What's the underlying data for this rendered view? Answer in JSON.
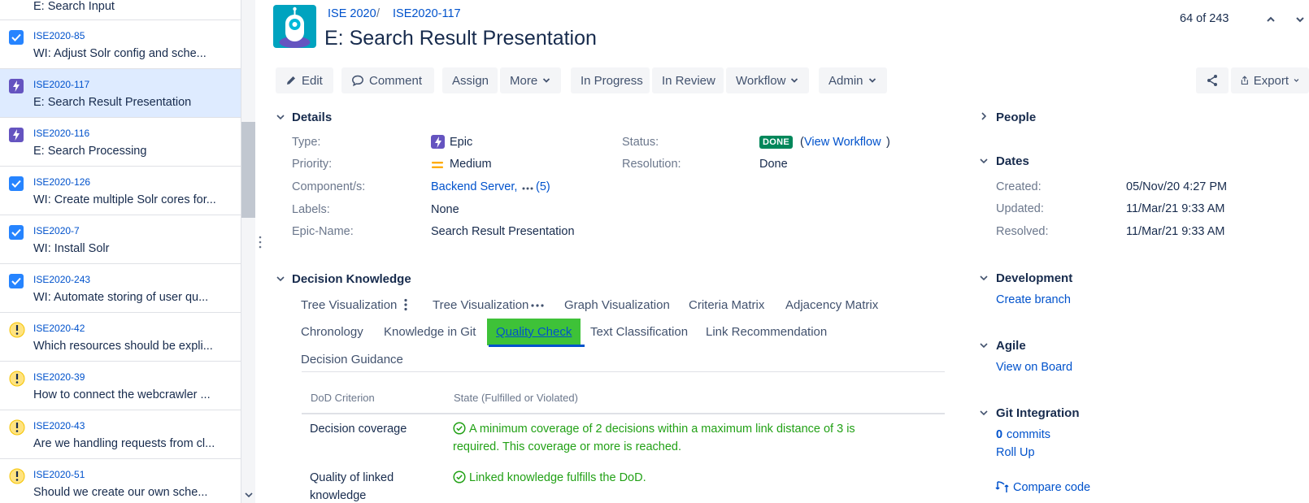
{
  "issue_list": [
    {
      "key": "",
      "summary": "E: Search Input",
      "type": "epic"
    },
    {
      "key": "ISE2020-85",
      "summary": "WI: Adjust Solr config and sche...",
      "type": "check"
    },
    {
      "key": "ISE2020-117",
      "summary": "E: Search Result Presentation",
      "type": "epic"
    },
    {
      "key": "ISE2020-116",
      "summary": "E: Search Processing",
      "type": "epic"
    },
    {
      "key": "ISE2020-126",
      "summary": "WI: Create multiple Solr cores for...",
      "type": "check"
    },
    {
      "key": "ISE2020-7",
      "summary": "WI: Install Solr",
      "type": "check"
    },
    {
      "key": "ISE2020-243",
      "summary": "WI: Automate storing of user qu...",
      "type": "check"
    },
    {
      "key": "ISE2020-42",
      "summary": "Which resources should be expli...",
      "type": "issue"
    },
    {
      "key": "ISE2020-39",
      "summary": "How to connect the webcrawler ...",
      "type": "issue"
    },
    {
      "key": "ISE2020-43",
      "summary": "Are we handling requests from cl...",
      "type": "issue"
    },
    {
      "key": "ISE2020-51",
      "summary": "Should we create our own sche...",
      "type": "issue"
    }
  ],
  "header": {
    "project": "ISE 2020",
    "separator": "/",
    "issue_key": "ISE2020-117",
    "title": "E: Search Result Presentation",
    "pager": "64 of 243"
  },
  "toolbar": {
    "edit": "Edit",
    "comment": "Comment",
    "assign": "Assign",
    "more": "More",
    "in_progress": "In Progress",
    "in_review": "In Review",
    "workflow": "Workflow",
    "admin": "Admin",
    "export": "Export"
  },
  "details": {
    "heading": "Details",
    "type_label": "Type:",
    "type_value": "Epic",
    "priority_label": "Priority:",
    "priority_value": "Medium",
    "components_label": "Component/s:",
    "components_value": "Backend Server,",
    "components_more": "(5)",
    "labels_label": "Labels:",
    "labels_value": "None",
    "epic_name_label": "Epic-Name:",
    "epic_name_value": "Search Result Presentation",
    "status_label": "Status:",
    "status_value": "DONE",
    "view_workflow_open": "(",
    "view_workflow": "View Workflow",
    "view_workflow_close": ")",
    "resolution_label": "Resolution:",
    "resolution_value": "Done"
  },
  "decision_knowledge": {
    "heading": "Decision Knowledge",
    "tabs": [
      "Tree Visualization",
      "Tree Visualization",
      "Graph Visualization",
      "Criteria Matrix",
      "Adjacency Matrix",
      "Chronology",
      "Knowledge in Git",
      "Quality Check",
      "Text Classification",
      "Link Recommendation",
      "Decision Guidance"
    ],
    "active_tab": "Quality Check",
    "table_headers": [
      "DoD Criterion",
      "State (Fulfilled or Violated)"
    ],
    "rows": [
      {
        "criterion": "Decision coverage",
        "state_line1": "A minimum coverage of 2 decisions within a maximum link distance of 3 is",
        "state_line2": "required. This coverage or more is reached."
      },
      {
        "criterion_line1": "Quality of linked",
        "criterion_line2": "knowledge",
        "state_line1": "Linked knowledge fulfills the DoD."
      }
    ]
  },
  "right": {
    "people": "People",
    "dates": "Dates",
    "created_label": "Created:",
    "created_value": "05/Nov/20 4:27 PM",
    "updated_label": "Updated:",
    "updated_value": "11/Mar/21 9:33 AM",
    "resolved_label": "Resolved:",
    "resolved_value": "11/Mar/21 9:33 AM",
    "development": "Development",
    "create_branch": "Create branch",
    "agile": "Agile",
    "view_on_board": "View on Board",
    "git_integration": "Git Integration",
    "commits_count": "0",
    "commits_label": "commits",
    "roll_up": "Roll Up",
    "compare_code": "Compare code"
  },
  "colors": {
    "link": "#0052cc",
    "done_lozenge": "#00875a",
    "quality_tab_bg": "#3ec238",
    "ok_text": "#22a116",
    "selected_row": "#deebff"
  }
}
